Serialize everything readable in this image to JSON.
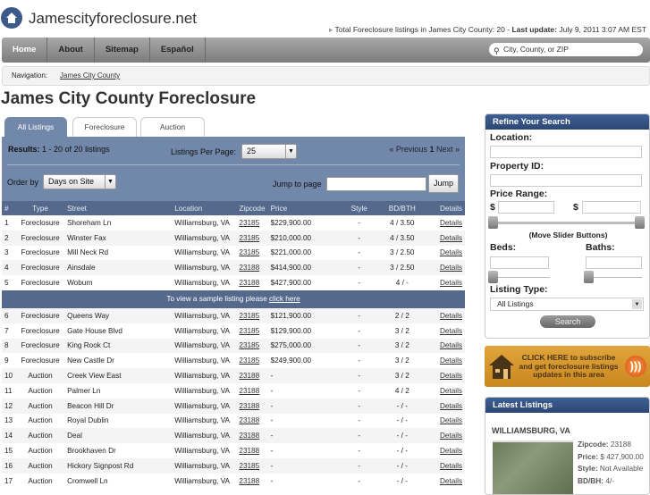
{
  "site": {
    "title": "Jamescityforeclosure.net",
    "total_prefix": "Total Foreclosure listings in James City County: 20 - ",
    "last_update_label": "Last update:",
    "last_update": "July 9, 2011 3:07 AM EST"
  },
  "nav": {
    "items": [
      "Home",
      "About",
      "Sitemap",
      "Español"
    ],
    "search_placeholder": "City, County, or ZIP"
  },
  "breadcrumb": {
    "label": "Navigation:",
    "link": "James City County"
  },
  "page_title": "James City County Foreclosure",
  "tabs": [
    "All Listings",
    "Foreclosure",
    "Auction"
  ],
  "controls": {
    "results_label": "Results:",
    "results": "1 - 20 of 20 listings",
    "per_page_label": "Listings Per Page:",
    "per_page": "25",
    "prev": "« Previous",
    "page": "1",
    "next": "Next »",
    "order_label": "Order by",
    "order": "Days on Site",
    "jump_label": "Jump to page",
    "jump_button": "Jump"
  },
  "table": {
    "headers": [
      "#",
      "Type",
      "Street",
      "Location",
      "Zipcode",
      "Price",
      "Style",
      "BD/BTH",
      "Details"
    ],
    "rows": [
      [
        "1",
        "Foreclosure",
        "Shoreham Ln",
        "Williamsburg, VA",
        "23185",
        "$229,900.00",
        "-",
        "4 / 3.50",
        "Details"
      ],
      [
        "2",
        "Foreclosure",
        "Winster Fax",
        "Williamsburg, VA",
        "23185",
        "$210,000.00",
        "-",
        "4 / 3.50",
        "Details"
      ],
      [
        "3",
        "Foreclosure",
        "Mill Neck Rd",
        "Williamsburg, VA",
        "23185",
        "$221,000.00",
        "-",
        "3 / 2.50",
        "Details"
      ],
      [
        "4",
        "Foreclosure",
        "Ainsdale",
        "Williamsburg, VA",
        "23188",
        "$414,900.00",
        "-",
        "3 / 2.50",
        "Details"
      ],
      [
        "5",
        "Foreclosure",
        "Woburn",
        "Williamsburg, VA",
        "23188",
        "$427,900.00",
        "-",
        "4 / -",
        "Details"
      ],
      [
        "6",
        "Foreclosure",
        "Queens Way",
        "Williamsburg, VA",
        "23185",
        "$121,900.00",
        "-",
        "2 / 2",
        "Details"
      ],
      [
        "7",
        "Foreclosure",
        "Gate House Blvd",
        "Williamsburg, VA",
        "23185",
        "$129,900.00",
        "-",
        "3 / 2",
        "Details"
      ],
      [
        "8",
        "Foreclosure",
        "King Rook Ct",
        "Williamsburg, VA",
        "23185",
        "$275,000.00",
        "-",
        "3 / 2",
        "Details"
      ],
      [
        "9",
        "Foreclosure",
        "New Castle Dr",
        "Williamsburg, VA",
        "23185",
        "$249,900.00",
        "-",
        "3 / 2",
        "Details"
      ],
      [
        "10",
        "Auction",
        "Creek View East",
        "Williamsburg, VA",
        "23188",
        "-",
        "-",
        "3 / 2",
        "Details"
      ],
      [
        "11",
        "Auction",
        "Palmer Ln",
        "Williamsburg, VA",
        "23188",
        "-",
        "-",
        "4 / 2",
        "Details"
      ],
      [
        "12",
        "Auction",
        "Beacon Hill Dr",
        "Williamsburg, VA",
        "23188",
        "-",
        "-",
        "- / -",
        "Details"
      ],
      [
        "13",
        "Auction",
        "Royal Dublin",
        "Williamsburg, VA",
        "23188",
        "-",
        "-",
        "- / -",
        "Details"
      ],
      [
        "14",
        "Auction",
        "Deal",
        "Williamsburg, VA",
        "23188",
        "-",
        "-",
        "- / -",
        "Details"
      ],
      [
        "15",
        "Auction",
        "Brookhaven Dr",
        "Williamsburg, VA",
        "23188",
        "-",
        "-",
        "- / -",
        "Details"
      ],
      [
        "16",
        "Auction",
        "Hickory Signpost Rd",
        "Williamsburg, VA",
        "23185",
        "-",
        "-",
        "- / -",
        "Details"
      ],
      [
        "17",
        "Auction",
        "Cromwell Ln",
        "Williamsburg, VA",
        "23188",
        "-",
        "-",
        "- / -",
        "Details"
      ]
    ],
    "sample_text": "To view a sample listing please ",
    "sample_link": "click here"
  },
  "refine": {
    "title": "Refine Your Search",
    "location": "Location:",
    "property_id": "Property ID:",
    "price_range": "Price Range:",
    "dollar": "$",
    "slider_hint": "(Move Slider Buttons)",
    "beds": "Beds:",
    "baths": "Baths:",
    "listing_type": "Listing Type:",
    "listing_type_value": "All Listings",
    "search_button": "Search"
  },
  "subscribe": {
    "text": "CLICK HERE to subscribe and get foreclosure listings updates in this area"
  },
  "latest": {
    "title": "Latest Listings",
    "city": "WILLIAMSBURG, VA",
    "zipcode_label": "Zipcode:",
    "zipcode": "23188",
    "price_label": "Price:",
    "price": "$ 427,900.00",
    "style_label": "Style:",
    "style": "Not Available",
    "bdbh_label": "BD/BH:",
    "bdbh": "4/-"
  }
}
